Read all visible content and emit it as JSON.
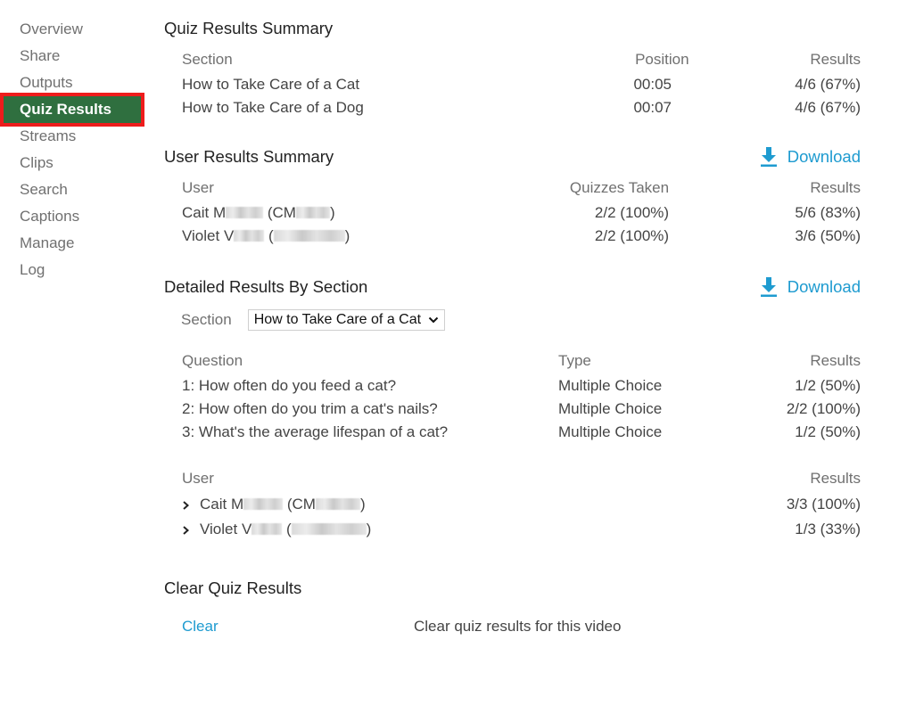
{
  "sidebar": {
    "items": [
      {
        "label": "Overview",
        "active": false
      },
      {
        "label": "Share",
        "active": false
      },
      {
        "label": "Outputs",
        "active": false
      },
      {
        "label": "Quiz Results",
        "active": true
      },
      {
        "label": "Streams",
        "active": false
      },
      {
        "label": "Clips",
        "active": false
      },
      {
        "label": "Search",
        "active": false
      },
      {
        "label": "Captions",
        "active": false
      },
      {
        "label": "Manage",
        "active": false
      },
      {
        "label": "Log",
        "active": false
      }
    ]
  },
  "quiz_summary": {
    "title": "Quiz Results Summary",
    "headers": {
      "section": "Section",
      "position": "Position",
      "results": "Results"
    },
    "rows": [
      {
        "section": "How to Take Care of a Cat",
        "position": "00:05",
        "results": "4/6 (67%)"
      },
      {
        "section": "How to Take Care of a Dog",
        "position": "00:07",
        "results": "4/6 (67%)"
      }
    ]
  },
  "user_summary": {
    "title": "User Results Summary",
    "download_label": "Download",
    "headers": {
      "user": "User",
      "quizzes_taken": "Quizzes Taken",
      "results": "Results"
    },
    "rows": [
      {
        "name_visible": "Cait M",
        "id_open": " (CM",
        "id_close": ")",
        "quizzes_taken": "2/2 (100%)",
        "results": "5/6 (83%)"
      },
      {
        "name_visible": "Violet V",
        "id_open": " (",
        "id_close": ")",
        "quizzes_taken": "2/2 (100%)",
        "results": "3/6 (50%)"
      }
    ]
  },
  "detailed": {
    "title": "Detailed Results By Section",
    "download_label": "Download",
    "section_label": "Section",
    "section_selected": "How to Take Care of a Cat",
    "question_headers": {
      "question": "Question",
      "type": "Type",
      "results": "Results"
    },
    "questions": [
      {
        "question": "1: How often do you feed a cat?",
        "type": "Multiple Choice",
        "results": "1/2 (50%)"
      },
      {
        "question": "2: How often do you trim a cat's nails?",
        "type": "Multiple Choice",
        "results": "2/2 (100%)"
      },
      {
        "question": "3: What's the average lifespan of a cat?",
        "type": "Multiple Choice",
        "results": "1/2 (50%)"
      }
    ],
    "user_headers": {
      "user": "User",
      "results": "Results"
    },
    "users": [
      {
        "name_visible": "Cait M",
        "id_open": " (CM",
        "id_close": ")",
        "results": "3/3 (100%)"
      },
      {
        "name_visible": "Violet V",
        "id_open": " (",
        "id_close": ")",
        "results": "1/3 (33%)"
      }
    ]
  },
  "clear": {
    "title": "Clear Quiz Results",
    "link_label": "Clear",
    "description": "Clear quiz results for this video"
  },
  "colors": {
    "accent": "#1e9bd0",
    "active_nav_bg": "#2f6f3f",
    "active_nav_border": "#ee1c1c"
  }
}
